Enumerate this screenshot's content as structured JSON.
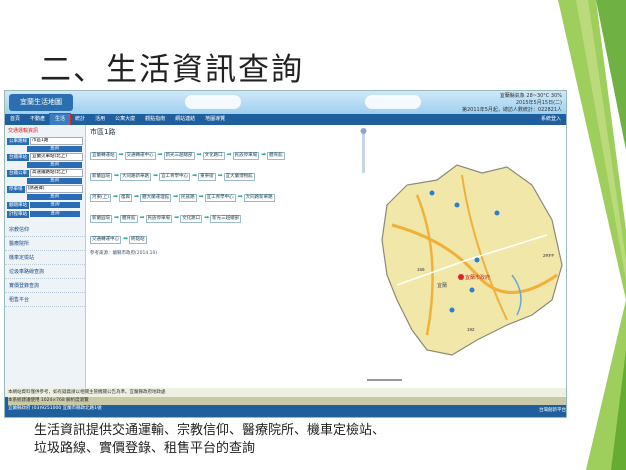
{
  "slide": {
    "title": "二、生活資訊查詢",
    "caption_line1": "生活資訊提供交通運輸、宗教信仰、醫療院所、機車定檢站、",
    "caption_line2": "垃圾路線、實價登錄、租售平台的查詢"
  },
  "screenshot": {
    "logo": "宜蘭生活地圖",
    "header_info": [
      "宜蘭縣氣象 28~30°C  30%",
      "2015年5月15日(二)",
      "第2011年5月起，總訪人數統計：022821人"
    ],
    "menu": [
      "首頁",
      "不動產",
      "生活",
      "統計",
      "活用",
      "公寓大廈",
      "觀點指南",
      "網站連結",
      "地圖導覽"
    ],
    "menu_active": "生活",
    "menu_right": "系統登入",
    "sidebar": {
      "title": "交通運輸資訊",
      "rows": [
        {
          "tag": "公車路線",
          "value": "市區1路"
        },
        {
          "tag": "台鐵車站",
          "value": "宜蘭火車站(北上)"
        },
        {
          "tag": "台鐵公車",
          "value": "高速鐵路站(北上)"
        },
        {
          "tag": "停車場",
          "value": "(請選擇)"
        },
        {
          "tag": "腳踏車站",
          "value": ""
        },
        {
          "tag": "計程車站",
          "value": ""
        }
      ],
      "search_label": "查詢",
      "links": [
        "宗教信仰",
        "醫療院所",
        "機車定檢站",
        "垃圾車路線查詢",
        "實價登錄查詢",
        "租售平台"
      ]
    },
    "route": {
      "title": "市區1路",
      "rows": [
        [
          "宜蘭轉運站",
          "交通轉運中心",
          "新光三越總部",
          "文化路口",
          "民族停車場",
          "體育館"
        ],
        [
          "新蘭圓環",
          "大同路新華路",
          "宜工青學中心",
          "東寧街",
          "宜大蘭博物館"
        ],
        [
          "河東(上)",
          "復興",
          "體大蘭運理館",
          "民族路",
          "宜工青學中心",
          "大同路新華路"
        ],
        [
          "新蘭圓環",
          "體育館",
          "民族停車場",
          "文化路口",
          "新光三越總部"
        ],
        [
          "交通轉運中心",
          "終點站"
        ]
      ],
      "source": "參考來源：蘭縣市政府(2014.10)"
    },
    "map": {
      "labels": [
        "宜蘭市政府",
        "宜蘭",
        "159",
        "192",
        "2RFF"
      ]
    },
    "statusbar": "本網站資料僅供參考，如有疑義請以相關主管機關公告為準。宜蘭縣政府地政處",
    "footer": {
      "line1": "本系統建議使用 1024×768 解析度瀏覽",
      "line2": "宜蘭縣政府 (03)9251000 宜蘭市縣政北路1號",
      "right": "台灣創新平台"
    }
  },
  "colors": {
    "menu_bg": "#1f5f9e",
    "green_deco": "#8dc63f",
    "district_fill": "#f1e7a8"
  }
}
